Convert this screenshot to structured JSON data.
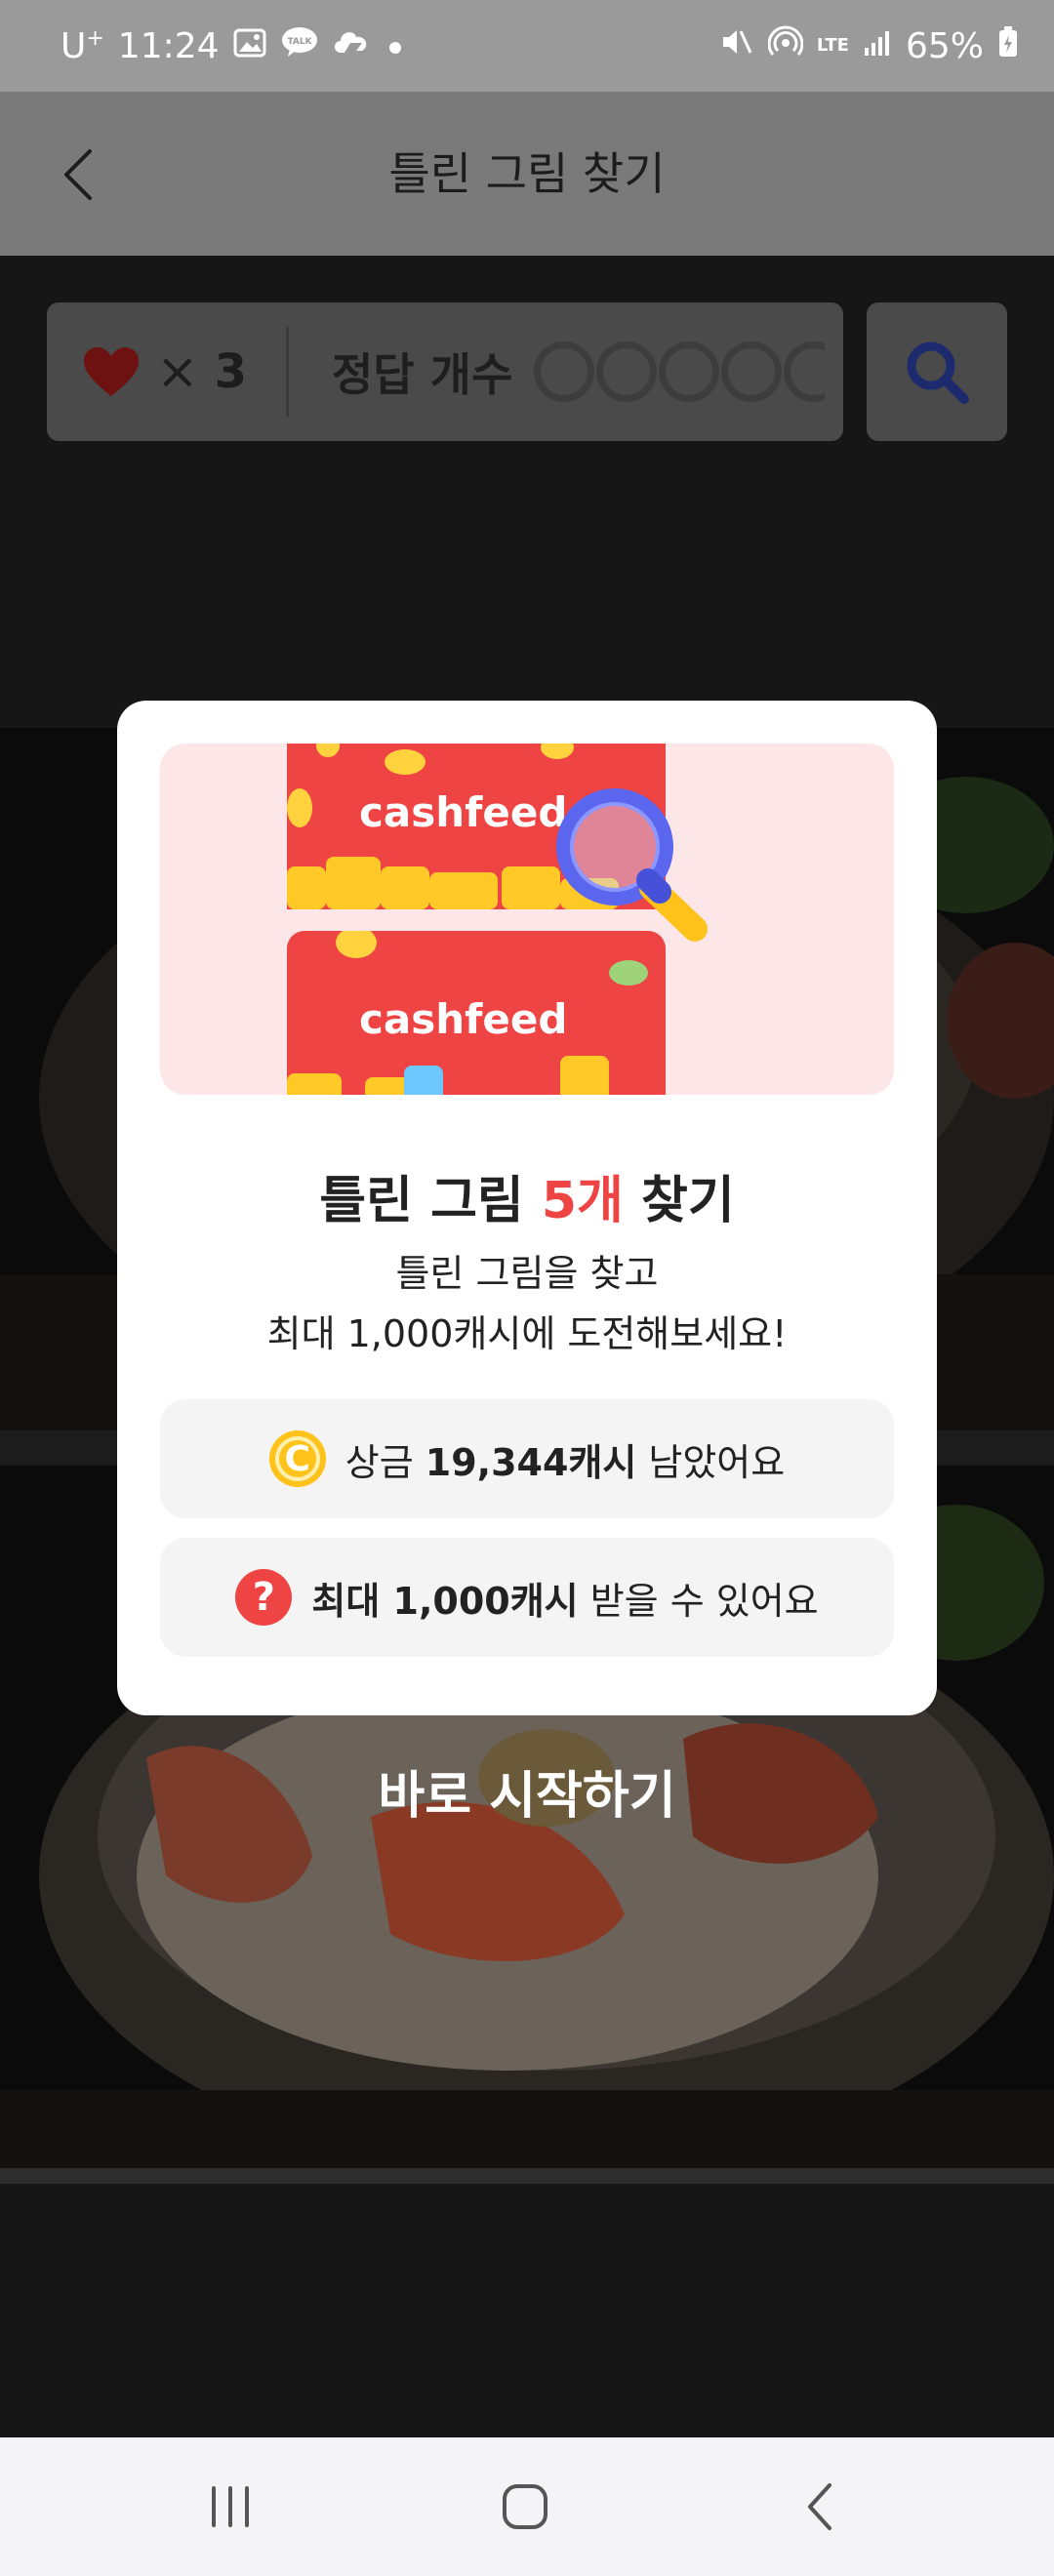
{
  "status_bar": {
    "carrier": "U",
    "carrier_sup": "+",
    "time": "11:24",
    "notification_icons": [
      "gallery-icon",
      "kakaotalk-icon",
      "cloud-icon",
      "dot-icon"
    ],
    "kakao_label": "TALK",
    "network": "LTE",
    "battery": "65%"
  },
  "header": {
    "title": "틀린 그림 찾기",
    "back_icon": "chevron-left-icon"
  },
  "game_info": {
    "lives_times": "×",
    "lives_count": "3",
    "answer_label": "정답 개수",
    "answer_total": 5,
    "answer_found": 0,
    "hint_icon": "magnifier-icon"
  },
  "modal": {
    "banner_brand": "cashfeed",
    "title_prefix": "틀린 그림 ",
    "title_accent": "5개",
    "title_suffix": " 찾기",
    "subtitle_line1": "틀린 그림을 찾고",
    "subtitle_line2": "최대 1,000캐시에 도전해보세요!",
    "prize_icon_text": "C",
    "prize_prefix": "상금 ",
    "prize_amount": "19,344캐시",
    "prize_suffix": " 남았어요",
    "max_icon_text": "?",
    "max_amount": "최대 1,000캐시",
    "max_suffix": " 받을 수 있어요"
  },
  "start_button": "바로 시작하기",
  "colors": {
    "accent_red": "#ee4444",
    "coin_yellow": "#ffc21b",
    "hint_blue": "#2d3dbd"
  },
  "nav_bar": {
    "recent_icon": "recent-apps-icon",
    "home_icon": "home-icon",
    "back_icon": "back-icon"
  }
}
